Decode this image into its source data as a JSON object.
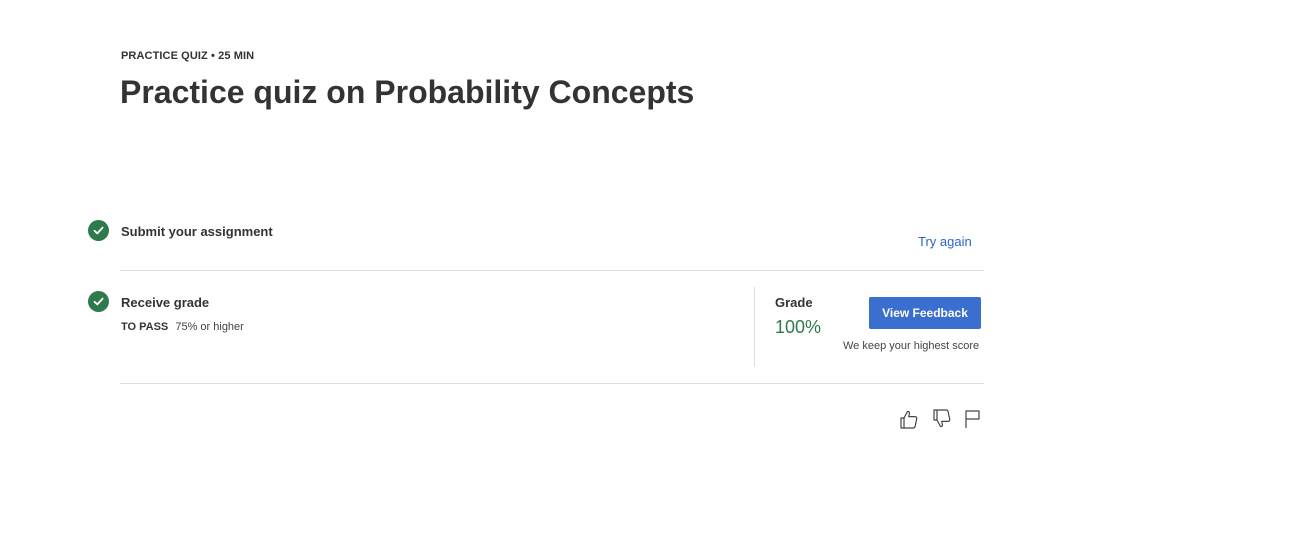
{
  "header": {
    "eyebrow": "PRACTICE QUIZ • 25 MIN",
    "title": "Practice quiz on Probability Concepts"
  },
  "steps": {
    "submit": {
      "title": "Submit your assignment",
      "action": "Try again",
      "status_icon": "check-circle-icon"
    },
    "receive": {
      "title": "Receive grade",
      "pass_label": "TO PASS",
      "pass_value": "75% or higher",
      "status_icon": "check-circle-icon"
    }
  },
  "grade": {
    "label": "Grade",
    "value": "100%",
    "button": "View Feedback",
    "note": "We keep your highest score"
  },
  "feedback_icons": [
    "thumbs-up-icon",
    "thumbs-down-icon",
    "flag-icon"
  ],
  "colors": {
    "success": "#2f7a4a",
    "accent": "#3a6fd0",
    "link": "#2a65c9",
    "text": "#333333"
  }
}
